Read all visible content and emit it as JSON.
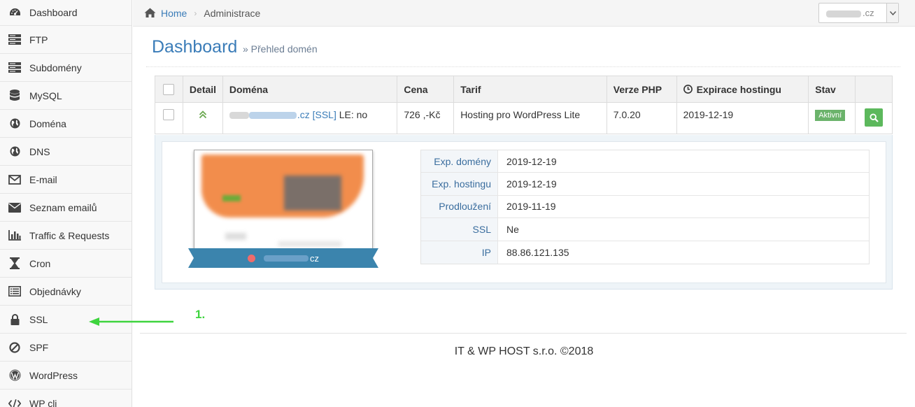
{
  "sidebar": {
    "items": [
      {
        "label": "Dashboard",
        "icon": "dashboard-icon"
      },
      {
        "label": "FTP",
        "icon": "server-icon"
      },
      {
        "label": "Subdomény",
        "icon": "server-icon"
      },
      {
        "label": "MySQL",
        "icon": "database-icon"
      },
      {
        "label": "Doména",
        "icon": "globe-icon"
      },
      {
        "label": "DNS",
        "icon": "globe-icon"
      },
      {
        "label": "E-mail",
        "icon": "envelope-outline-icon"
      },
      {
        "label": "Seznam emailů",
        "icon": "envelope-icon"
      },
      {
        "label": "Traffic & Requests",
        "icon": "bar-chart-icon"
      },
      {
        "label": "Cron",
        "icon": "hourglass-icon"
      },
      {
        "label": "Objednávky",
        "icon": "list-icon"
      },
      {
        "label": "SSL",
        "icon": "lock-icon"
      },
      {
        "label": "SPF",
        "icon": "ban-icon"
      },
      {
        "label": "WordPress",
        "icon": "wordpress-icon"
      },
      {
        "label": "WP cli",
        "icon": "code-icon"
      }
    ]
  },
  "topbar": {
    "breadcrumb_home": "Home",
    "breadcrumb_current": "Administrace",
    "domain_select_suffix": ".cz"
  },
  "header": {
    "title": "Dashboard",
    "subtitle": "» Přehled domén"
  },
  "table": {
    "columns": [
      "Detail",
      "Doména",
      "Cena",
      "Tarif",
      "Verze PHP",
      "Expirace hostingu",
      "Stav"
    ],
    "row": {
      "domain_suffix": ".cz",
      "ssl_link": "[SSL]",
      "le_text": "LE: no",
      "price": "726 ,-Kč",
      "tariff": "Hosting pro WordPress Lite",
      "php": "7.0.20",
      "expiration": "2019-12-19",
      "status": "Aktivní"
    }
  },
  "detail": {
    "ribbon_suffix": "cz",
    "rows": [
      {
        "key": "Exp. domény",
        "value": "2019-12-19"
      },
      {
        "key": "Exp. hostingu",
        "value": "2019-12-19"
      },
      {
        "key": "Prodloužení",
        "value": "2019-11-19"
      },
      {
        "key": "SSL",
        "value": "Ne"
      },
      {
        "key": "IP",
        "value": "88.86.121.135"
      }
    ]
  },
  "annotation": {
    "label": "1.",
    "color": "#3ed43e"
  },
  "footer": {
    "text": "IT & WP HOST s.r.o. ©2018"
  },
  "colors": {
    "accent": "#3a7cb8",
    "success": "#5cb85c",
    "ribbon": "#3b84ad"
  }
}
